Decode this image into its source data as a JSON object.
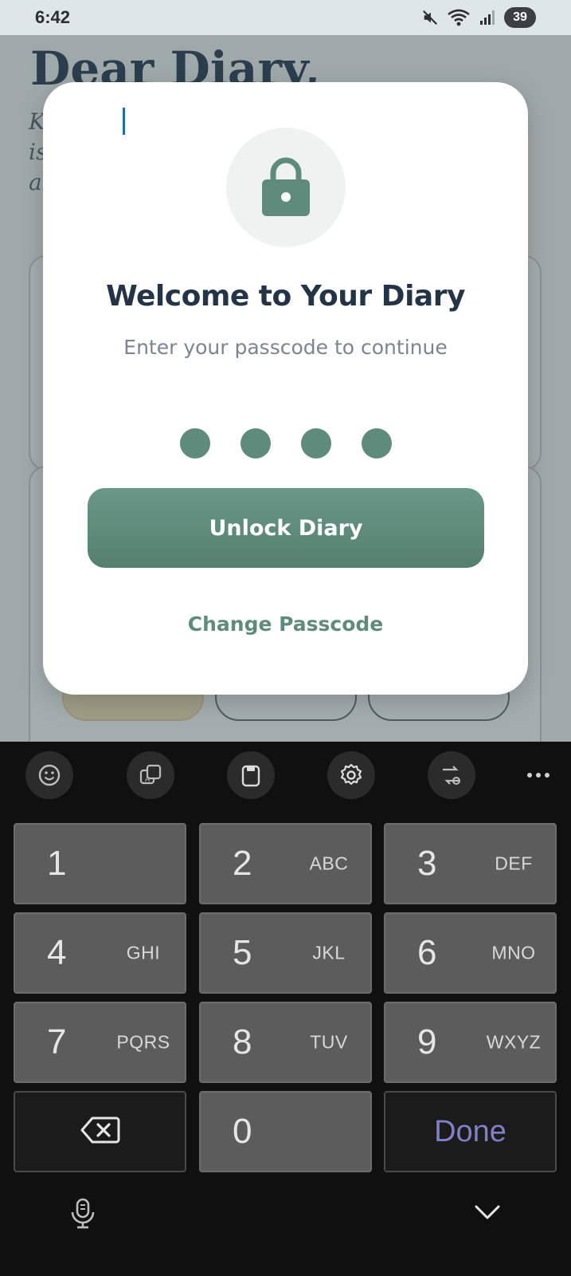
{
  "status_bar": {
    "time": "6:42",
    "battery": "39",
    "icons": [
      "mute-icon",
      "wifi-icon",
      "signal-icon",
      "battery-icon"
    ]
  },
  "background_app": {
    "title": "Dear Diary,",
    "subtitle_fragments": [
      "K",
      "is",
      "a"
    ]
  },
  "modal": {
    "icon": "lock-icon",
    "title": "Welcome to Your Diary",
    "subtitle": "Enter your passcode to continue",
    "passcode_dots": 4,
    "unlock_label": "Unlock Diary",
    "change_label": "Change Passcode",
    "colors": {
      "accent": "#5f8b7d",
      "title": "#243447",
      "subtitle": "#7a8591"
    }
  },
  "keyboard": {
    "toolbar": [
      "emoji-icon",
      "text-style-icon",
      "clipboard-icon",
      "settings-icon",
      "translate-icon",
      "more-icon"
    ],
    "keys": [
      {
        "num": "1",
        "letters": ""
      },
      {
        "num": "2",
        "letters": "ABC"
      },
      {
        "num": "3",
        "letters": "DEF"
      },
      {
        "num": "4",
        "letters": "GHI"
      },
      {
        "num": "5",
        "letters": "JKL"
      },
      {
        "num": "6",
        "letters": "MNO"
      },
      {
        "num": "7",
        "letters": "PQRS"
      },
      {
        "num": "8",
        "letters": "TUV"
      },
      {
        "num": "9",
        "letters": "WXYZ"
      }
    ],
    "zero": "0",
    "done": "Done",
    "colors": {
      "done": "#7f80c9",
      "key": "#5c5c5c",
      "background": "#101010"
    }
  }
}
